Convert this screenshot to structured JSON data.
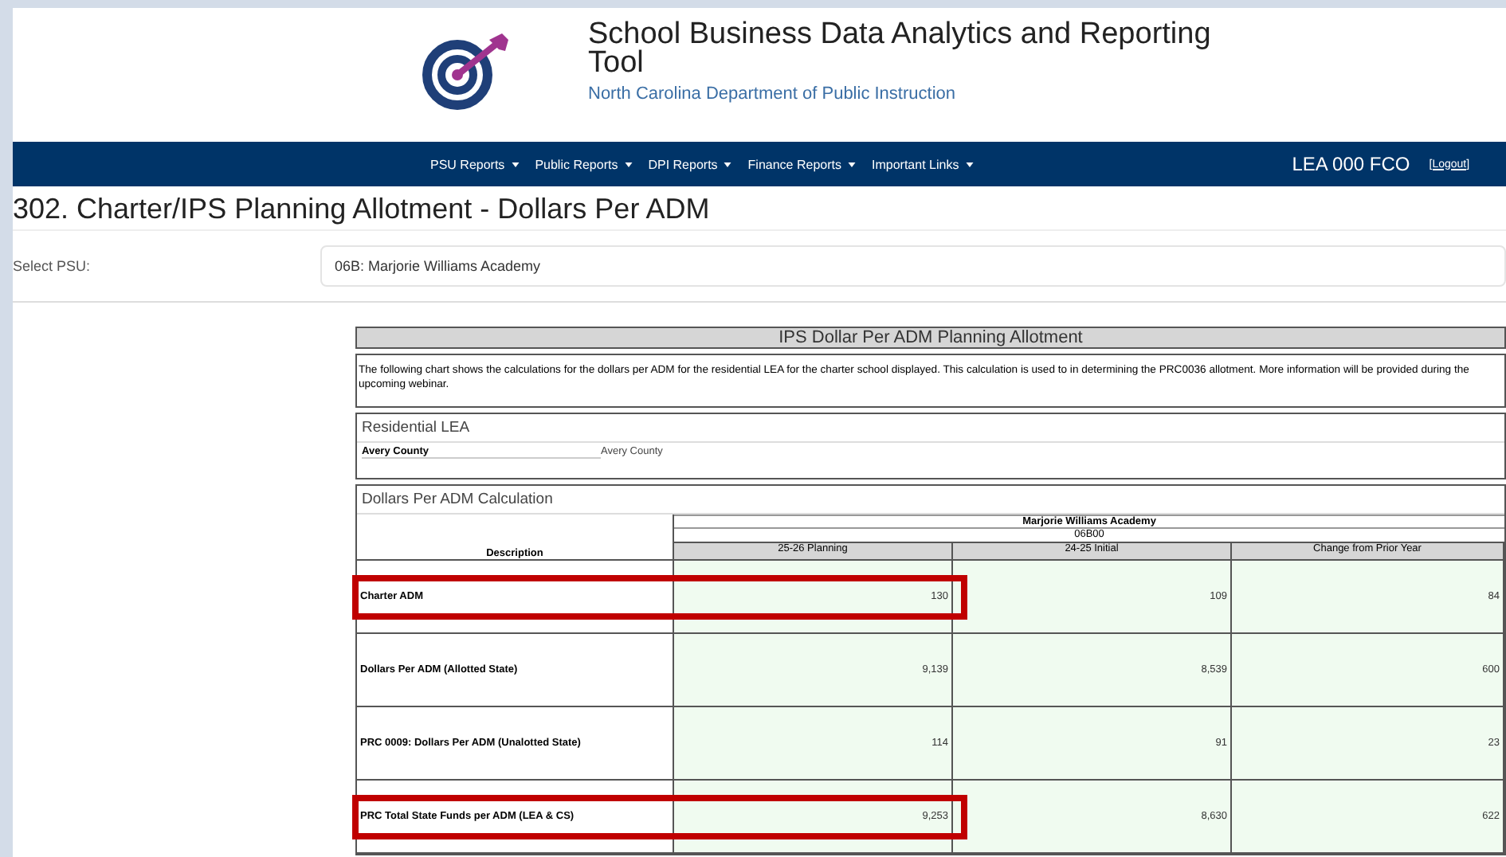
{
  "header": {
    "title": "School Business Data Analytics and Reporting Tool",
    "subtitle": "North Carolina Department of Public Instruction"
  },
  "nav": {
    "menus": [
      "PSU Reports",
      "Public Reports",
      "DPI Reports",
      "Finance Reports",
      "Important Links"
    ],
    "user": "LEA 000 FCO",
    "logout": "[Logout]"
  },
  "page_title": "302. Charter/IPS Planning Allotment - Dollars Per ADM",
  "psu_select": {
    "label": "Select PSU:",
    "value": "06B: Marjorie Williams Academy"
  },
  "report": {
    "title": "IPS Dollar Per ADM Planning Allotment",
    "note": "The following chart shows the calculations for the dollars per ADM for the residential LEA for the charter school displayed. This calculation is used to in determining the PRC0036 allotment. More information will be provided during the upcoming webinar.",
    "residential": {
      "title": "Residential LEA",
      "label": "Avery County",
      "value": "Avery County"
    },
    "calculation": {
      "title": "Dollars Per ADM Calculation",
      "school": "Marjorie Williams Academy",
      "code": "06B00",
      "description_header": "Description",
      "columns": [
        "25-26 Planning",
        "24-25 Initial",
        "Change from Prior Year"
      ],
      "rows": [
        {
          "description": "Charter ADM",
          "values": [
            "130",
            "109",
            "84"
          ],
          "highlighted": true
        },
        {
          "description": "Dollars Per ADM (Allotted State)",
          "values": [
            "9,139",
            "8,539",
            "600"
          ],
          "highlighted": false
        },
        {
          "description": "PRC 0009: Dollars Per ADM (Unalotted State)",
          "values": [
            "114",
            "91",
            "23"
          ],
          "highlighted": false
        },
        {
          "description": "PRC Total State Funds per ADM (LEA & CS)",
          "values": [
            "9,253",
            "8,630",
            "622"
          ],
          "highlighted": true
        }
      ]
    }
  }
}
